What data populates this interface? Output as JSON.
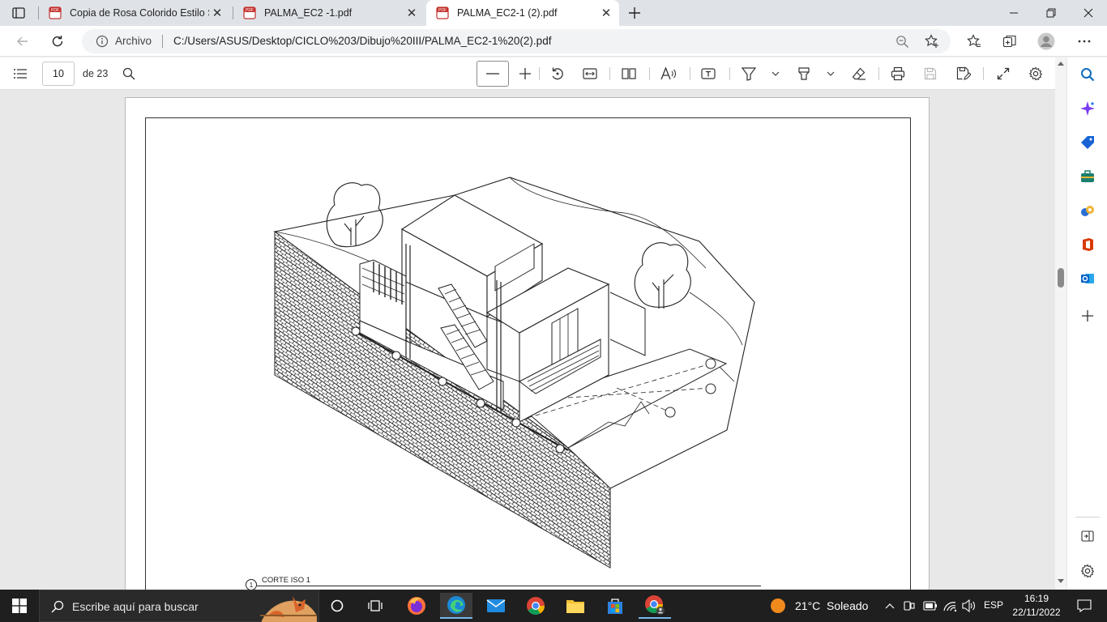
{
  "tabs": [
    {
      "title": "Copia de Rosa Colorido Estilo Se",
      "active": false
    },
    {
      "title": "PALMA_EC2 -1.pdf",
      "active": false
    },
    {
      "title": "PALMA_EC2-1 (2).pdf",
      "active": true
    }
  ],
  "address": {
    "site_label": "Archivo",
    "url": "C:/Users/ASUS/Desktop/CICLO%203/Dibujo%20III/PALMA_EC2-1%20(2).pdf"
  },
  "pdf_toolbar": {
    "page_input": "10",
    "page_total": "de 23"
  },
  "document": {
    "view_number": "1",
    "view_title": "CORTE ISO 1"
  },
  "taskbar": {
    "search_placeholder": "Escribe aquí para buscar",
    "weather": "21°C  Soleado",
    "language": "ESP",
    "time": "16:19",
    "date": "22/11/2022"
  },
  "colors": {
    "accent": "#0f6cbd",
    "taskbar": "#1f1f1f",
    "tabbar": "#dfe3e8"
  }
}
